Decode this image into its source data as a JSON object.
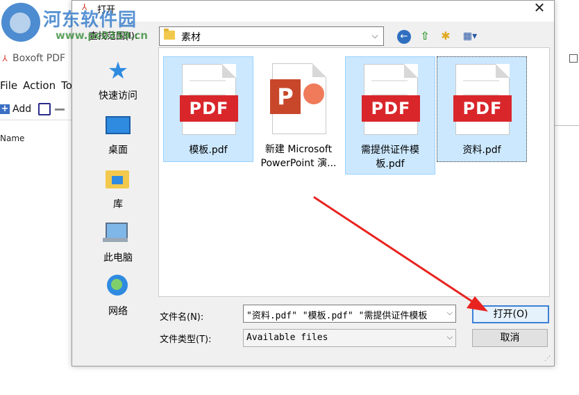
{
  "watermark": {
    "text": "河东软件园",
    "url": "www.pc0359.cn"
  },
  "background_app": {
    "title": "Boxoft PDF",
    "menu": [
      "File",
      "Action",
      "To"
    ],
    "toolbar_add": "Add",
    "column_name": "Name"
  },
  "dialog": {
    "title": "打开",
    "close_label": "✕",
    "look_in_label": "查找范围(I):",
    "look_in_value": "素材",
    "places": [
      {
        "label": "快速访问",
        "icon": "star-icon"
      },
      {
        "label": "桌面",
        "icon": "desktop-icon"
      },
      {
        "label": "库",
        "icon": "library-icon"
      },
      {
        "label": "此电脑",
        "icon": "computer-icon"
      },
      {
        "label": "网络",
        "icon": "network-icon"
      }
    ],
    "files": [
      {
        "name": "模板.pdf",
        "type": "pdf",
        "badge": "PDF",
        "selected": true
      },
      {
        "name": "新建 Microsoft PowerPoint 演...",
        "type": "ppt",
        "badge": "P",
        "selected": false
      },
      {
        "name": "需提供证件模板.pdf",
        "type": "pdf",
        "badge": "PDF",
        "selected": true
      },
      {
        "name": "资料.pdf",
        "type": "pdf",
        "badge": "PDF",
        "selected": true
      }
    ],
    "filename_label": "文件名(N):",
    "filename_value": "\"资料.pdf\" \"模板.pdf\" \"需提供证件模板",
    "filetype_label": "文件类型(T):",
    "filetype_value": "Available files",
    "open_button": "打开(O)",
    "cancel_button": "取消"
  },
  "colors": {
    "accent": "#3c7fd6",
    "selection": "#cce8ff",
    "pdf_red": "#d9262b",
    "arrow": "#e8231f"
  }
}
